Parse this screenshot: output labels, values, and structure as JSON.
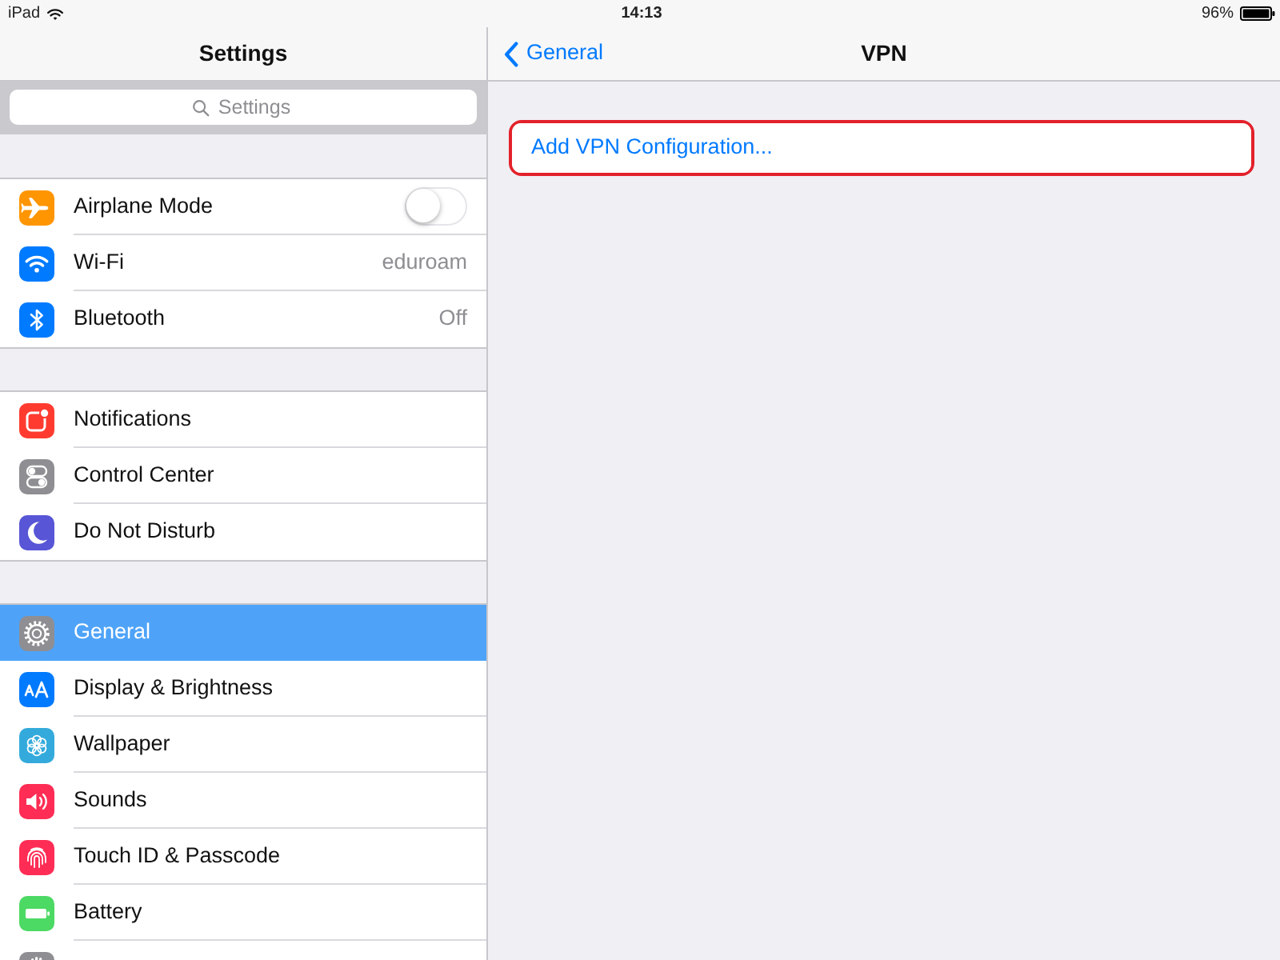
{
  "status_bar": {
    "device": "iPad",
    "time": "14:13",
    "battery": "96%"
  },
  "sidebar": {
    "title": "Settings",
    "search": {
      "placeholder": "Settings"
    },
    "groups": [
      {
        "items": [
          {
            "label": "Airplane Mode",
            "kind": "toggle",
            "on": false,
            "color": "#ff9500",
            "selected": false
          },
          {
            "label": "Wi-Fi",
            "kind": "value",
            "value": "eduroam",
            "color": "#007aff",
            "selected": false
          },
          {
            "label": "Bluetooth",
            "kind": "value",
            "value": "Off",
            "color": "#007aff",
            "selected": false
          }
        ]
      },
      {
        "items": [
          {
            "label": "Notifications",
            "kind": "plain",
            "color": "#ff3b30",
            "selected": false
          },
          {
            "label": "Control Center",
            "kind": "plain",
            "color": "#8e8e93",
            "selected": false
          },
          {
            "label": "Do Not Disturb",
            "kind": "plain",
            "color": "#5856d6",
            "selected": false
          }
        ]
      },
      {
        "items": [
          {
            "label": "General",
            "kind": "plain",
            "color": "#8e8e93",
            "selected": true
          },
          {
            "label": "Display & Brightness",
            "kind": "plain",
            "color": "#007aff",
            "selected": false
          },
          {
            "label": "Wallpaper",
            "kind": "plain",
            "color": "#34aadc",
            "selected": false
          },
          {
            "label": "Sounds",
            "kind": "plain",
            "color": "#ff2d55",
            "selected": false
          },
          {
            "label": "Touch ID & Passcode",
            "kind": "plain",
            "color": "#ff2d55",
            "selected": false
          },
          {
            "label": "Battery",
            "kind": "plain",
            "color": "#4cd964",
            "selected": false
          },
          {
            "kind": "plain",
            "color": "#8e8e93",
            "selected": false
          }
        ]
      }
    ]
  },
  "detail": {
    "back": "General",
    "title": "VPN",
    "rows": [
      {
        "label": "Add VPN Configuration...",
        "highlighted": true
      }
    ]
  }
}
